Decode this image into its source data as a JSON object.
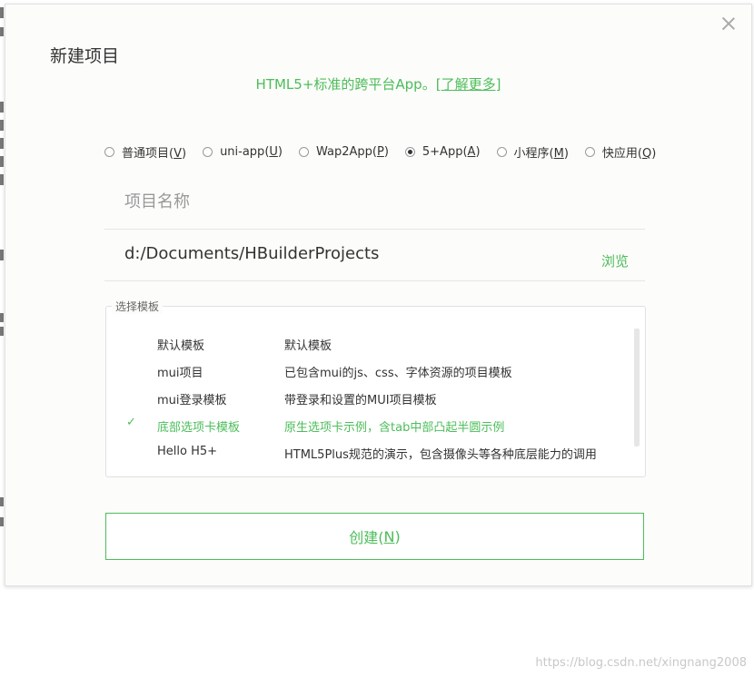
{
  "dialog": {
    "title": "新建项目",
    "subtitle": "HTML5+标准的跨平台App。",
    "learn_more": "[了解更多]"
  },
  "project_types": [
    {
      "label": "普通项目(",
      "mn": "V",
      "tail": ")",
      "checked": false
    },
    {
      "label": "uni-app(",
      "mn": "U",
      "tail": ")",
      "checked": false
    },
    {
      "label": "Wap2App(",
      "mn": "P",
      "tail": ")",
      "checked": false
    },
    {
      "label": "5+App(",
      "mn": "A",
      "tail": ")",
      "checked": true
    },
    {
      "label": "小程序(",
      "mn": "M",
      "tail": ")",
      "checked": false
    },
    {
      "label": "快应用(",
      "mn": "Q",
      "tail": ")",
      "checked": false
    }
  ],
  "project_name": {
    "placeholder": "项目名称",
    "value": ""
  },
  "location": {
    "value": "d:/Documents/HBuilderProjects",
    "browse_label": "浏览"
  },
  "templates": {
    "legend": "选择模板",
    "items": [
      {
        "name": "默认模板",
        "desc": "默认模板",
        "check": ""
      },
      {
        "name": "mui项目",
        "desc": "已包含mui的js、css、字体资源的项目模板",
        "check": ""
      },
      {
        "name": "mui登录模板",
        "desc": "带登录和设置的MUI项目模板",
        "check": ""
      },
      {
        "name": "底部选项卡模板",
        "desc": "原生选项卡示例，含tab中部凸起半圆示例",
        "check": "✓"
      },
      {
        "name": "Hello H5+",
        "desc": "HTML5Plus规范的演示，包含摄像头等各种底层能力的调用",
        "check": ""
      }
    ],
    "selected_index": 3
  },
  "create_button": {
    "label": "创建(",
    "mn": "N",
    "tail": ")"
  },
  "watermark": "https://blog.csdn.net/xingnang2008",
  "colors": {
    "accent": "#4cbd5a"
  }
}
